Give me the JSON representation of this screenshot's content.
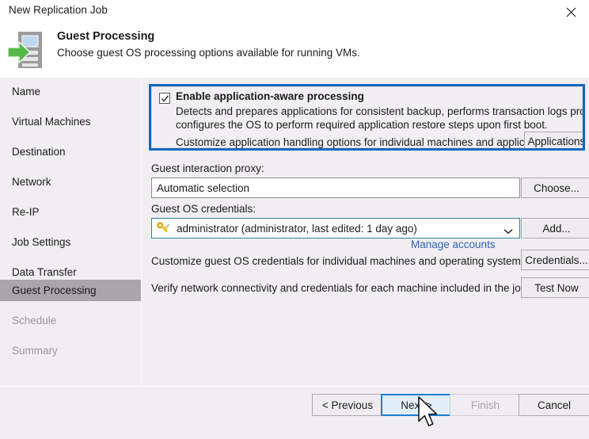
{
  "window": {
    "title": "New Replication Job",
    "close_icon": "close-icon"
  },
  "header": {
    "icon": "vm-replication-icon",
    "title": "Guest Processing",
    "subtitle": "Choose guest OS processing options available for running VMs."
  },
  "sidebar": {
    "items": [
      {
        "label": "Name",
        "state": "enabled"
      },
      {
        "label": "Virtual Machines",
        "state": "enabled"
      },
      {
        "label": "Destination",
        "state": "enabled"
      },
      {
        "label": "Network",
        "state": "enabled"
      },
      {
        "label": "Re-IP",
        "state": "enabled"
      },
      {
        "label": "Job Settings",
        "state": "enabled"
      },
      {
        "label": "Data Transfer",
        "state": "enabled"
      },
      {
        "label": "Guest Processing",
        "state": "active"
      },
      {
        "label": "Schedule",
        "state": "disabled"
      },
      {
        "label": "Summary",
        "state": "disabled"
      }
    ]
  },
  "main": {
    "app_aware": {
      "checkbox_label": "Enable application-aware processing",
      "checked": true,
      "description_line1": "Detects and prepares applications for consistent backup, performs transaction logs processing, and",
      "description_line2": "configures the OS to perform required application restore steps upon first boot.",
      "customize_text": "Customize application handling options for individual machines and applications",
      "applications_button": "Applications...",
      "highlight_color": "#1566c0"
    },
    "guest_proxy": {
      "label": "Guest interaction proxy:",
      "value": "Automatic selection",
      "placeholder": "Automatic selection",
      "choose_button": "Choose..."
    },
    "guest_credentials": {
      "label": "Guest OS credentials:",
      "value": "administrator (administrator, last edited: 1 day ago)",
      "icon": "key-icon",
      "caret_icon": "chevron-down-icon",
      "add_button": "Add...",
      "manage_link": "Manage accounts",
      "manage_link_color": "#2f62b5"
    },
    "credentials_row": {
      "text": "Customize guest OS credentials for individual machines and operating systems",
      "button": "Credentials..."
    },
    "test_row": {
      "text": "Verify network connectivity and credentials for each machine included in the job",
      "button": "Test Now"
    }
  },
  "footer": {
    "previous_button": "< Previous",
    "next_button": "Next >",
    "finish_button": "Finish",
    "cancel_button": "Cancel",
    "finish_disabled": true,
    "next_is_default": true,
    "accent_color": "#1b7fd4"
  }
}
